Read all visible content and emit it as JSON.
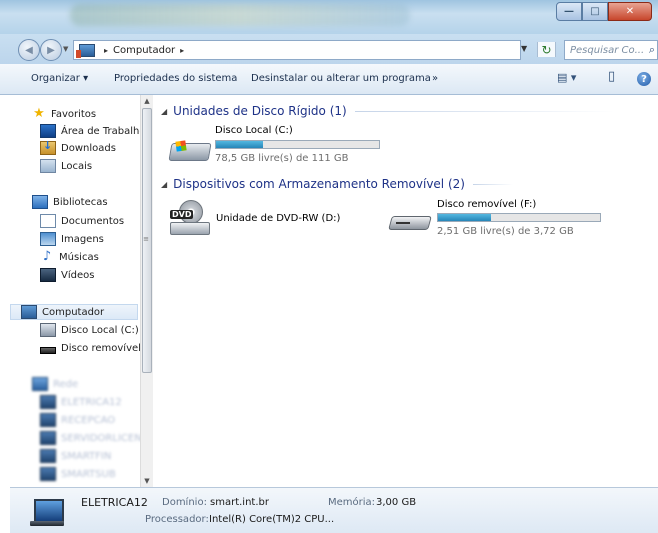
{
  "window": {
    "minimize_glyph": "—",
    "maximize_glyph": "□",
    "close_glyph": "✕"
  },
  "address": {
    "crumbs": [
      "Computador"
    ],
    "separator": "▸",
    "search_placeholder": "Pesquisar Co..."
  },
  "toolbar": {
    "organize": "Organizar ▾",
    "system_properties": "Propriedades do sistema",
    "uninstall": "Desinstalar ou alterar um programa",
    "more": "»",
    "view_glyph": "▤ ▾",
    "preview_glyph": "▯",
    "help_glyph": "?"
  },
  "nav": {
    "favorites": {
      "title": "Favoritos",
      "items": [
        "Área de Trabalho",
        "Downloads",
        "Locais"
      ]
    },
    "libraries": {
      "title": "Bibliotecas",
      "items": [
        "Documentos",
        "Imagens",
        "Músicas",
        "Vídeos"
      ]
    },
    "computer": {
      "title": "Computador",
      "items": [
        "Disco Local (C:)",
        "Disco removível (F:)"
      ]
    },
    "network": {
      "title": "Rede",
      "items": [
        "ELETRICA12",
        "RECEPCAO",
        "SERVIDORLICENCA",
        "SMARTFIN",
        "SMARTSUB"
      ]
    }
  },
  "content": {
    "hard_disks_header": "Unidades de Disco Rígido (1)",
    "removable_header": "Dispositivos com Armazenamento Removível (2)",
    "drives": {
      "c": {
        "name": "Disco Local (C:)",
        "free_text": "78,5 GB livre(s) de 111 GB",
        "used_fraction": 0.29
      },
      "dvd": {
        "name": "Unidade de DVD-RW (D:)",
        "label": "DVD"
      },
      "f": {
        "name": "Disco removível (F:)",
        "free_text": "2,51 GB livre(s) de 3,72 GB",
        "used_fraction": 0.33
      }
    }
  },
  "details": {
    "computer_name": "ELETRICA12",
    "domain_label": "Domínio:",
    "domain_value": "smart.int.br",
    "memory_label": "Memória:",
    "memory_value": "3,00 GB",
    "processor_label": "Processador:",
    "processor_value": "Intel(R) Core(TM)2 CPU..."
  },
  "colors": {
    "accent_bar": "#2685b8",
    "group_header": "#1e3287",
    "toolbar_bg": "#dce8f4"
  }
}
